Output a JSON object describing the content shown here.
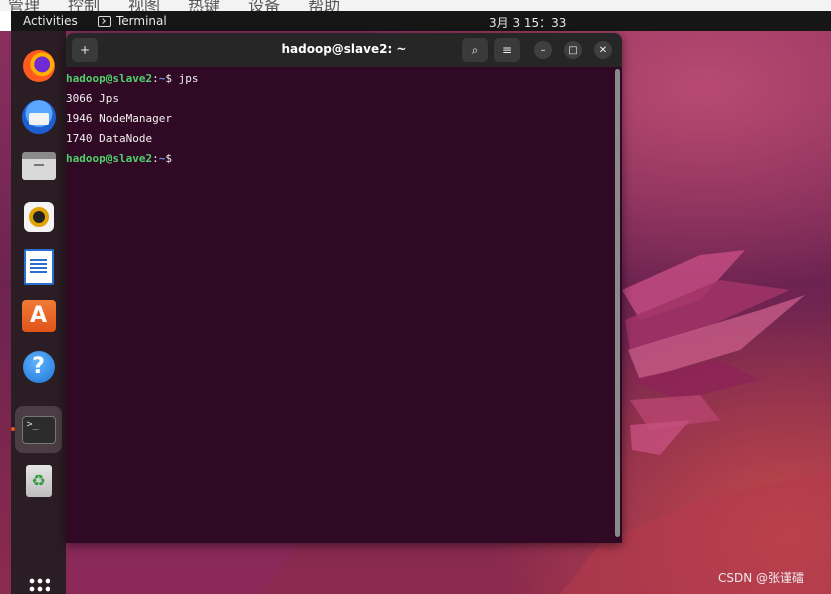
{
  "host": {
    "menu_items": [
      "管理",
      "控制",
      "视图",
      "热键",
      "设备",
      "帮助"
    ]
  },
  "topbar": {
    "activities": "Activities",
    "app_name": "Terminal",
    "clock": "3月 3  15：33"
  },
  "dock": {
    "items": [
      {
        "name": "firefox",
        "icon": "firefox-icon"
      },
      {
        "name": "thunderbird",
        "icon": "thunderbird-icon"
      },
      {
        "name": "files",
        "icon": "files-icon"
      },
      {
        "name": "rhythmbox",
        "icon": "rhythmbox-icon"
      },
      {
        "name": "libreoffice-writer",
        "icon": "writer-icon"
      },
      {
        "name": "ubuntu-software",
        "icon": "store-icon",
        "glyph": "A"
      },
      {
        "name": "help",
        "icon": "help-icon",
        "glyph": "?"
      },
      {
        "name": "terminal",
        "icon": "terminal-icon",
        "glyph": ">_",
        "active": true
      },
      {
        "name": "trash",
        "icon": "trash-icon",
        "glyph": "♻"
      },
      {
        "name": "show-apps",
        "icon": "app-grid-icon"
      }
    ],
    "accent_color": "#e95420"
  },
  "terminal": {
    "title": "hadoop@slave2: ~",
    "new_tab_glyph": "+",
    "search_glyph": "⌕",
    "menu_glyph": "≡",
    "minimize_glyph": "–",
    "maximize_glyph": "□",
    "close_glyph": "✕",
    "background": "#300a24",
    "lines": [
      {
        "user": "hadoop@slave2",
        "sep": ":",
        "path": "~",
        "rest": "$ jps"
      },
      {
        "text": "3066 Jps"
      },
      {
        "text": "1946 NodeManager"
      },
      {
        "text": "1740 DataNode"
      },
      {
        "user": "hadoop@slave2",
        "sep": ":",
        "path": "~",
        "rest": "$ "
      }
    ]
  },
  "watermark": "CSDN @张谨礌"
}
